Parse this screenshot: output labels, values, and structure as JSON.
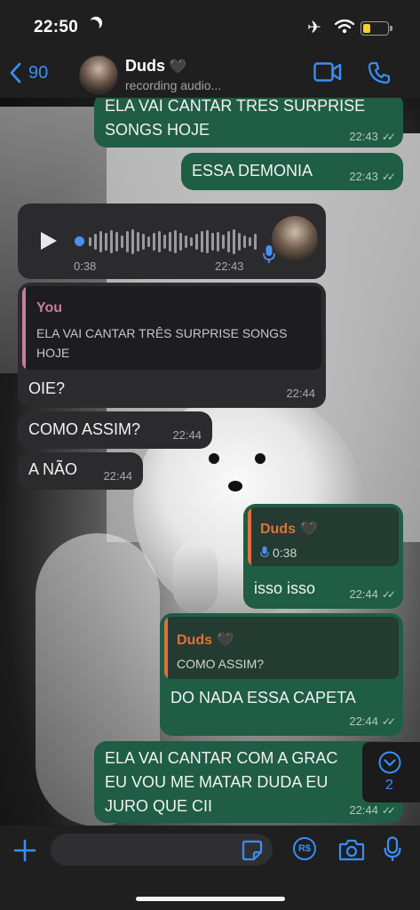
{
  "status_bar": {
    "time": "22:50"
  },
  "header": {
    "back_count": "90",
    "contact_name": "Duds",
    "contact_emoji": "🖤",
    "status": "recording audio..."
  },
  "messages": [
    {
      "id": "m1",
      "direction": "out",
      "text_lines": [
        "ELA VAI CANTAR TRES SURPRISE",
        "SONGS HOJE"
      ],
      "time": "22:43",
      "read": true
    },
    {
      "id": "m2",
      "direction": "out",
      "text": "ESSA DEMONIA",
      "time": "22:43",
      "read": true
    },
    {
      "id": "m3",
      "direction": "in",
      "type": "voice",
      "duration": "0:38",
      "time": "22:43"
    },
    {
      "id": "m4",
      "direction": "in",
      "quote": {
        "name": "You",
        "text_lines": [
          "ELA VAI CANTAR TRÊS SURPRISE SONGS",
          "HOJE"
        ]
      },
      "text": "OIE?",
      "time": "22:44"
    },
    {
      "id": "m5",
      "direction": "in",
      "text": "COMO ASSIM?",
      "time": "22:44"
    },
    {
      "id": "m6",
      "direction": "in",
      "text": "A NÃO",
      "time": "22:44"
    },
    {
      "id": "m7",
      "direction": "out",
      "quote": {
        "name": "Duds",
        "emoji": "🖤",
        "voice_duration": "0:38"
      },
      "text": "isso isso",
      "time": "22:44",
      "read": true
    },
    {
      "id": "m8",
      "direction": "out",
      "quote": {
        "name": "Duds",
        "emoji": "🖤",
        "text": "COMO ASSIM?"
      },
      "text": "DO NADA ESSA CAPETA",
      "time": "22:44",
      "read": true
    },
    {
      "id": "m9",
      "direction": "out",
      "text_lines": [
        "ELA VAI CANTAR COM A GRAC",
        "EU VOU ME MATAR DUDA EU",
        "JURO QUE CII"
      ],
      "time": "22:44",
      "read": true
    }
  ],
  "scroll_button": {
    "unread_count": "2"
  },
  "composer": {
    "pay_label": "R$"
  },
  "icons": {
    "back": "chevron-left-icon",
    "video": "video-camera-icon",
    "call": "phone-icon",
    "plus": "plus-icon",
    "sticker": "sticker-icon",
    "camera": "camera-icon",
    "mic": "microphone-icon"
  },
  "colors": {
    "accent": "#3a8ef6",
    "outgoing_bubble": "#1f5d45",
    "incoming_bubble": "#2b2b2e",
    "you_quote": "#c87d9b",
    "duds_quote": "#e36f3c"
  }
}
